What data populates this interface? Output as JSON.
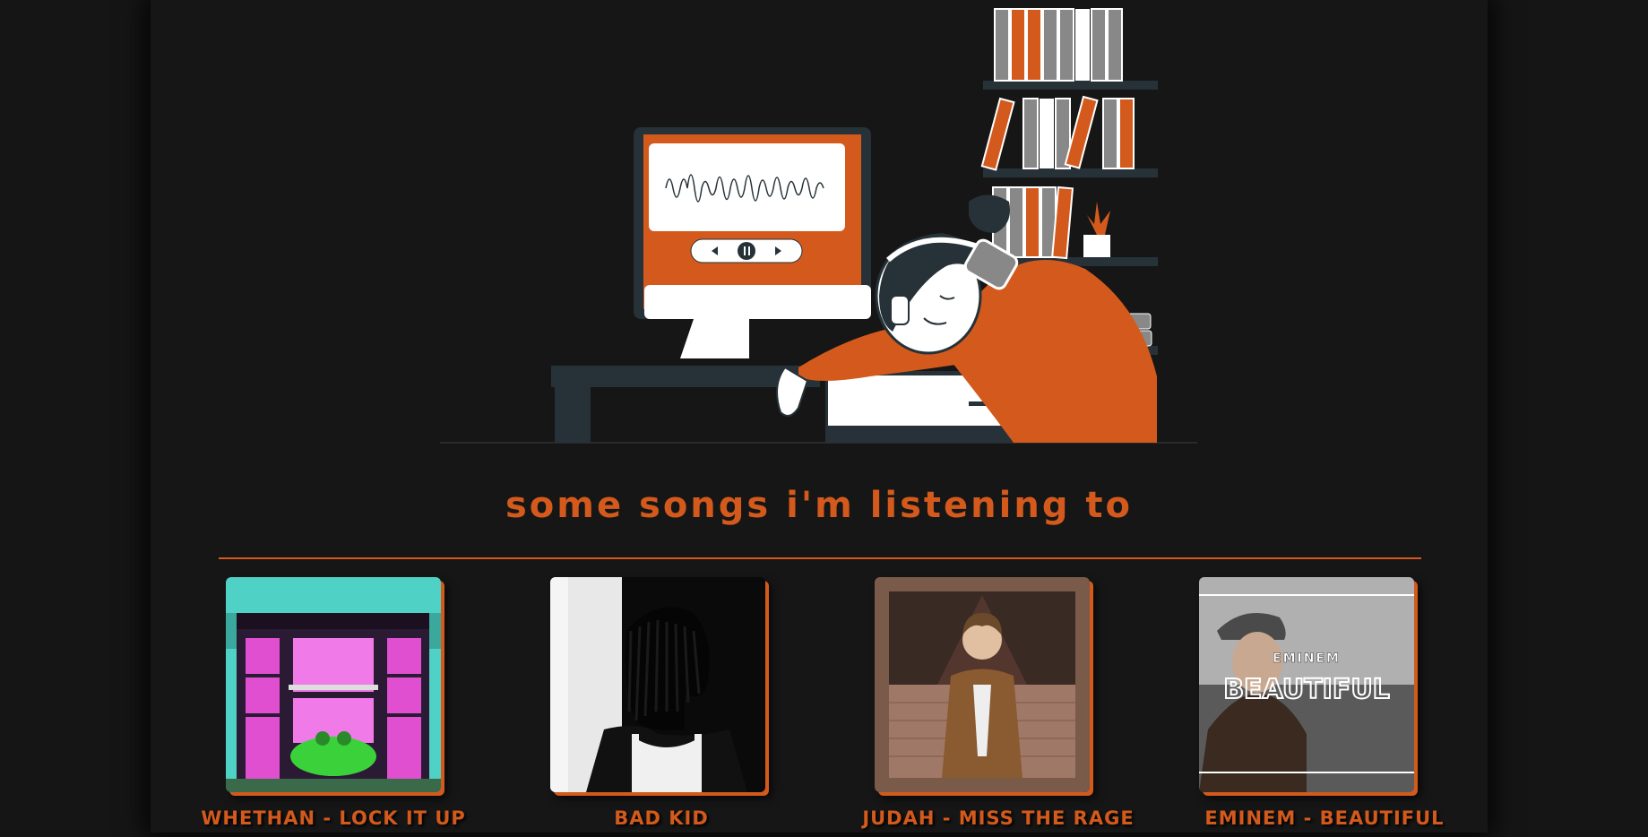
{
  "hero": {
    "illustration_name": "sleeping-listener-illustration",
    "accent_color": "#d35a1c",
    "dark_color": "#263238"
  },
  "section": {
    "title": "some songs i'm listening to"
  },
  "songs": [
    {
      "title": "WHETHAN - LOCK IT UP",
      "cover_icon": "lock-it-up-cover"
    },
    {
      "title": "BAD KID",
      "cover_icon": "bad-kid-cover"
    },
    {
      "title": "JUDAH - MISS THE RAGE",
      "cover_icon": "miss-the-rage-cover"
    },
    {
      "title": "EMINEM - BEAUTIFUL",
      "cover_icon": "beautiful-cover",
      "cover_text_top": "EMINEM",
      "cover_text_main": "BEAUTIFUL"
    }
  ],
  "colors": {
    "background": "#161616",
    "accent": "#d35a1c"
  }
}
